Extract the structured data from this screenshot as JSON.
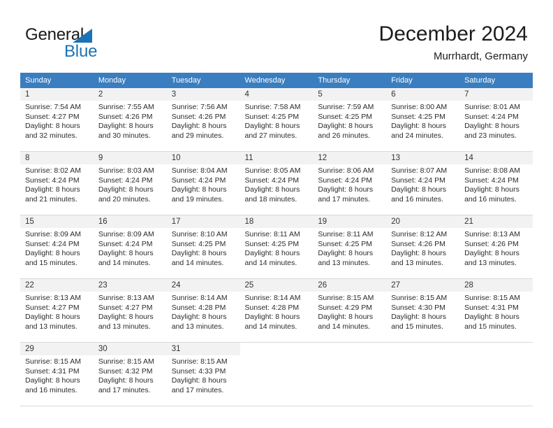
{
  "brand": {
    "name_top": "General",
    "name_bottom": "Blue",
    "accent_color": "#1a72b8"
  },
  "header": {
    "title": "December 2024",
    "subtitle": "Murrhardt, Germany"
  },
  "calendar": {
    "header_bg": "#3a7ebf",
    "daynum_bg": "#f2f2f2",
    "weekday_headers": [
      "Sunday",
      "Monday",
      "Tuesday",
      "Wednesday",
      "Thursday",
      "Friday",
      "Saturday"
    ],
    "weeks": [
      [
        {
          "day": "1",
          "sunrise": "Sunrise: 7:54 AM",
          "sunset": "Sunset: 4:27 PM",
          "daylight_line1": "Daylight: 8 hours",
          "daylight_line2": "and 32 minutes."
        },
        {
          "day": "2",
          "sunrise": "Sunrise: 7:55 AM",
          "sunset": "Sunset: 4:26 PM",
          "daylight_line1": "Daylight: 8 hours",
          "daylight_line2": "and 30 minutes."
        },
        {
          "day": "3",
          "sunrise": "Sunrise: 7:56 AM",
          "sunset": "Sunset: 4:26 PM",
          "daylight_line1": "Daylight: 8 hours",
          "daylight_line2": "and 29 minutes."
        },
        {
          "day": "4",
          "sunrise": "Sunrise: 7:58 AM",
          "sunset": "Sunset: 4:25 PM",
          "daylight_line1": "Daylight: 8 hours",
          "daylight_line2": "and 27 minutes."
        },
        {
          "day": "5",
          "sunrise": "Sunrise: 7:59 AM",
          "sunset": "Sunset: 4:25 PM",
          "daylight_line1": "Daylight: 8 hours",
          "daylight_line2": "and 26 minutes."
        },
        {
          "day": "6",
          "sunrise": "Sunrise: 8:00 AM",
          "sunset": "Sunset: 4:25 PM",
          "daylight_line1": "Daylight: 8 hours",
          "daylight_line2": "and 24 minutes."
        },
        {
          "day": "7",
          "sunrise": "Sunrise: 8:01 AM",
          "sunset": "Sunset: 4:24 PM",
          "daylight_line1": "Daylight: 8 hours",
          "daylight_line2": "and 23 minutes."
        }
      ],
      [
        {
          "day": "8",
          "sunrise": "Sunrise: 8:02 AM",
          "sunset": "Sunset: 4:24 PM",
          "daylight_line1": "Daylight: 8 hours",
          "daylight_line2": "and 21 minutes."
        },
        {
          "day": "9",
          "sunrise": "Sunrise: 8:03 AM",
          "sunset": "Sunset: 4:24 PM",
          "daylight_line1": "Daylight: 8 hours",
          "daylight_line2": "and 20 minutes."
        },
        {
          "day": "10",
          "sunrise": "Sunrise: 8:04 AM",
          "sunset": "Sunset: 4:24 PM",
          "daylight_line1": "Daylight: 8 hours",
          "daylight_line2": "and 19 minutes."
        },
        {
          "day": "11",
          "sunrise": "Sunrise: 8:05 AM",
          "sunset": "Sunset: 4:24 PM",
          "daylight_line1": "Daylight: 8 hours",
          "daylight_line2": "and 18 minutes."
        },
        {
          "day": "12",
          "sunrise": "Sunrise: 8:06 AM",
          "sunset": "Sunset: 4:24 PM",
          "daylight_line1": "Daylight: 8 hours",
          "daylight_line2": "and 17 minutes."
        },
        {
          "day": "13",
          "sunrise": "Sunrise: 8:07 AM",
          "sunset": "Sunset: 4:24 PM",
          "daylight_line1": "Daylight: 8 hours",
          "daylight_line2": "and 16 minutes."
        },
        {
          "day": "14",
          "sunrise": "Sunrise: 8:08 AM",
          "sunset": "Sunset: 4:24 PM",
          "daylight_line1": "Daylight: 8 hours",
          "daylight_line2": "and 16 minutes."
        }
      ],
      [
        {
          "day": "15",
          "sunrise": "Sunrise: 8:09 AM",
          "sunset": "Sunset: 4:24 PM",
          "daylight_line1": "Daylight: 8 hours",
          "daylight_line2": "and 15 minutes."
        },
        {
          "day": "16",
          "sunrise": "Sunrise: 8:09 AM",
          "sunset": "Sunset: 4:24 PM",
          "daylight_line1": "Daylight: 8 hours",
          "daylight_line2": "and 14 minutes."
        },
        {
          "day": "17",
          "sunrise": "Sunrise: 8:10 AM",
          "sunset": "Sunset: 4:25 PM",
          "daylight_line1": "Daylight: 8 hours",
          "daylight_line2": "and 14 minutes."
        },
        {
          "day": "18",
          "sunrise": "Sunrise: 8:11 AM",
          "sunset": "Sunset: 4:25 PM",
          "daylight_line1": "Daylight: 8 hours",
          "daylight_line2": "and 14 minutes."
        },
        {
          "day": "19",
          "sunrise": "Sunrise: 8:11 AM",
          "sunset": "Sunset: 4:25 PM",
          "daylight_line1": "Daylight: 8 hours",
          "daylight_line2": "and 13 minutes."
        },
        {
          "day": "20",
          "sunrise": "Sunrise: 8:12 AM",
          "sunset": "Sunset: 4:26 PM",
          "daylight_line1": "Daylight: 8 hours",
          "daylight_line2": "and 13 minutes."
        },
        {
          "day": "21",
          "sunrise": "Sunrise: 8:13 AM",
          "sunset": "Sunset: 4:26 PM",
          "daylight_line1": "Daylight: 8 hours",
          "daylight_line2": "and 13 minutes."
        }
      ],
      [
        {
          "day": "22",
          "sunrise": "Sunrise: 8:13 AM",
          "sunset": "Sunset: 4:27 PM",
          "daylight_line1": "Daylight: 8 hours",
          "daylight_line2": "and 13 minutes."
        },
        {
          "day": "23",
          "sunrise": "Sunrise: 8:13 AM",
          "sunset": "Sunset: 4:27 PM",
          "daylight_line1": "Daylight: 8 hours",
          "daylight_line2": "and 13 minutes."
        },
        {
          "day": "24",
          "sunrise": "Sunrise: 8:14 AM",
          "sunset": "Sunset: 4:28 PM",
          "daylight_line1": "Daylight: 8 hours",
          "daylight_line2": "and 13 minutes."
        },
        {
          "day": "25",
          "sunrise": "Sunrise: 8:14 AM",
          "sunset": "Sunset: 4:28 PM",
          "daylight_line1": "Daylight: 8 hours",
          "daylight_line2": "and 14 minutes."
        },
        {
          "day": "26",
          "sunrise": "Sunrise: 8:15 AM",
          "sunset": "Sunset: 4:29 PM",
          "daylight_line1": "Daylight: 8 hours",
          "daylight_line2": "and 14 minutes."
        },
        {
          "day": "27",
          "sunrise": "Sunrise: 8:15 AM",
          "sunset": "Sunset: 4:30 PM",
          "daylight_line1": "Daylight: 8 hours",
          "daylight_line2": "and 15 minutes."
        },
        {
          "day": "28",
          "sunrise": "Sunrise: 8:15 AM",
          "sunset": "Sunset: 4:31 PM",
          "daylight_line1": "Daylight: 8 hours",
          "daylight_line2": "and 15 minutes."
        }
      ],
      [
        {
          "day": "29",
          "sunrise": "Sunrise: 8:15 AM",
          "sunset": "Sunset: 4:31 PM",
          "daylight_line1": "Daylight: 8 hours",
          "daylight_line2": "and 16 minutes."
        },
        {
          "day": "30",
          "sunrise": "Sunrise: 8:15 AM",
          "sunset": "Sunset: 4:32 PM",
          "daylight_line1": "Daylight: 8 hours",
          "daylight_line2": "and 17 minutes."
        },
        {
          "day": "31",
          "sunrise": "Sunrise: 8:15 AM",
          "sunset": "Sunset: 4:33 PM",
          "daylight_line1": "Daylight: 8 hours",
          "daylight_line2": "and 17 minutes."
        },
        {
          "day": "",
          "sunrise": "",
          "sunset": "",
          "daylight_line1": "",
          "daylight_line2": ""
        },
        {
          "day": "",
          "sunrise": "",
          "sunset": "",
          "daylight_line1": "",
          "daylight_line2": ""
        },
        {
          "day": "",
          "sunrise": "",
          "sunset": "",
          "daylight_line1": "",
          "daylight_line2": ""
        },
        {
          "day": "",
          "sunrise": "",
          "sunset": "",
          "daylight_line1": "",
          "daylight_line2": ""
        }
      ]
    ]
  }
}
